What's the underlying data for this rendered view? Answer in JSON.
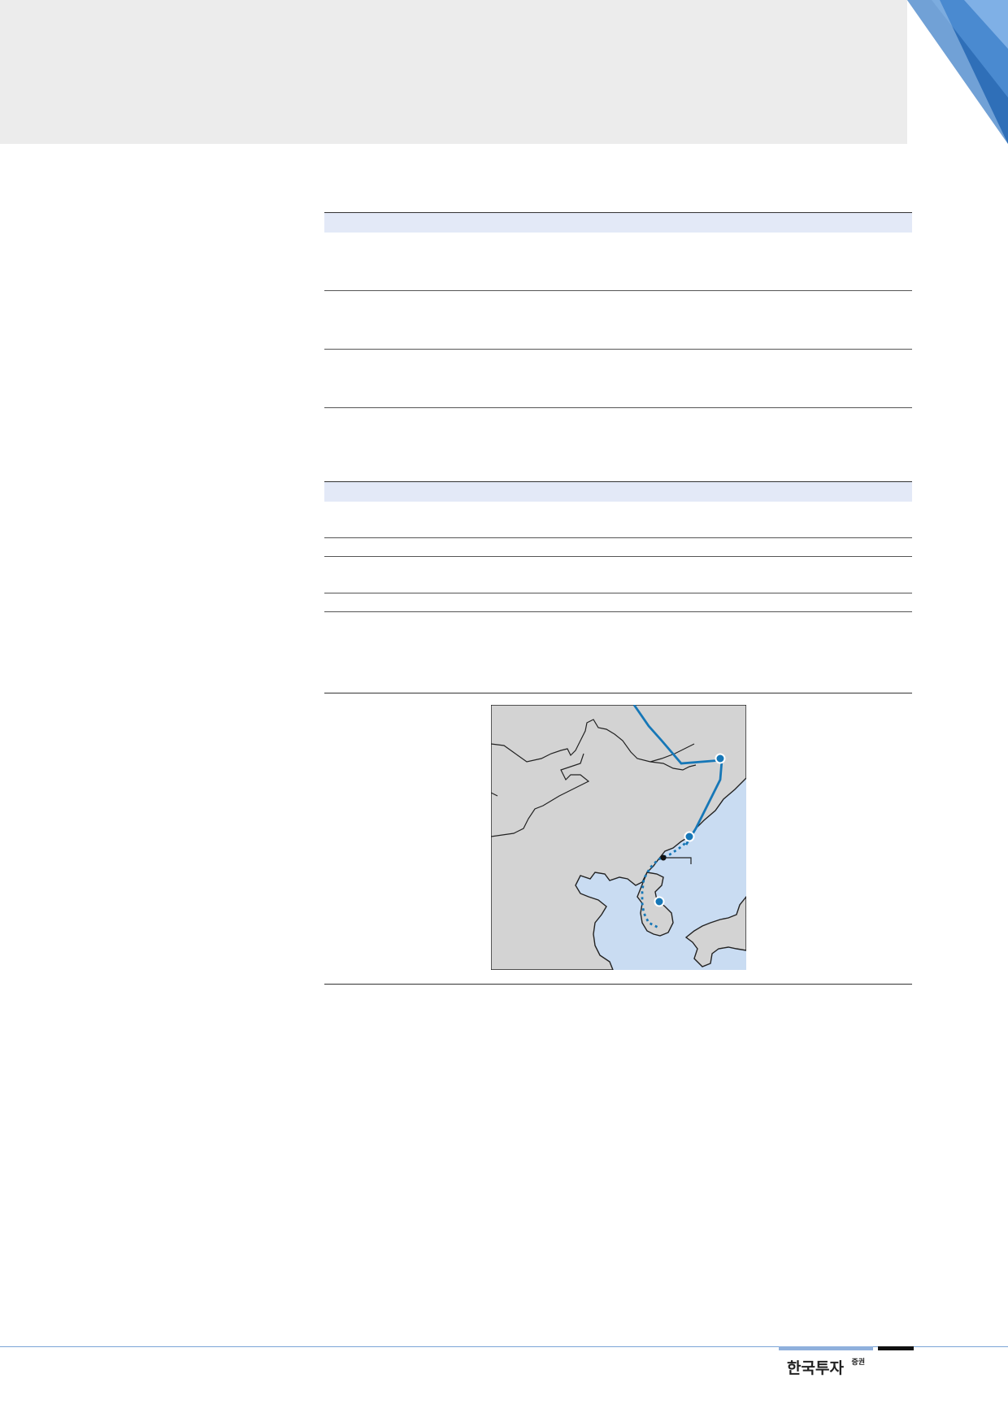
{
  "branding": {
    "name": "한국투자",
    "suffix": "증권",
    "accent_color": "#1f78b4",
    "header_band_color": "#ececec",
    "table_header_color": "#e3e9f7"
  },
  "map": {
    "land_color": "#d3d3d3",
    "sea_color": "#c9dcf2",
    "route_color": "#1677b7",
    "icons": [
      "route-node-marker",
      "branch-point-marker"
    ]
  }
}
